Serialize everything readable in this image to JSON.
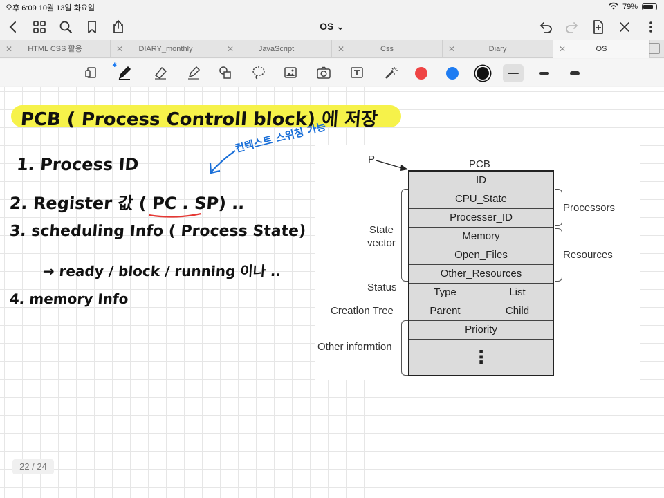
{
  "status_bar": {
    "time_date": "오후 6:09   10월 13일 화요일",
    "battery": "79%",
    "battery_level": 0.79
  },
  "nav": {
    "title": "OS ⌄"
  },
  "tabs": [
    {
      "label": "HTML CSS 활용"
    },
    {
      "label": "DIARY_monthly"
    },
    {
      "label": "JavaScript"
    },
    {
      "label": "Css"
    },
    {
      "label": "Diary"
    },
    {
      "label": "OS"
    }
  ],
  "toolbar": {
    "colors": [
      "#ef4444",
      "#1e7cf2",
      "#111111"
    ],
    "selected_color": "#111111"
  },
  "notes": {
    "title": "PCB ( Process Controll block) 에 저장",
    "line1": "1. Process ID",
    "line2": "2. Register 값 ( PC . SP) ..",
    "line3": "3. scheduling Info ( Process State)",
    "line3b": "→ ready / block / running 이나 ..",
    "line4": "4. memory Info",
    "annotation": "컨텍스트 스위칭 가능"
  },
  "pcb": {
    "pointer": "P",
    "title": "PCB",
    "rows": {
      "id": "ID",
      "cpu_state": "CPU_State",
      "processer_id": "Processer_ID",
      "memory": "Memory",
      "open_files": "Open_Files",
      "other_resources": "Other_Resources",
      "type": "Type",
      "list": "List",
      "parent": "Parent",
      "child": "Child",
      "priority": "Priority",
      "dots": "⋮"
    },
    "labels": {
      "processors": "Processors",
      "resources": "Resources",
      "state_vector": "State\nvector",
      "status": "Status",
      "creation_tree": "Creatlon Tree",
      "other_information": "Other informtion"
    }
  },
  "page_indicator": "22 / 24"
}
